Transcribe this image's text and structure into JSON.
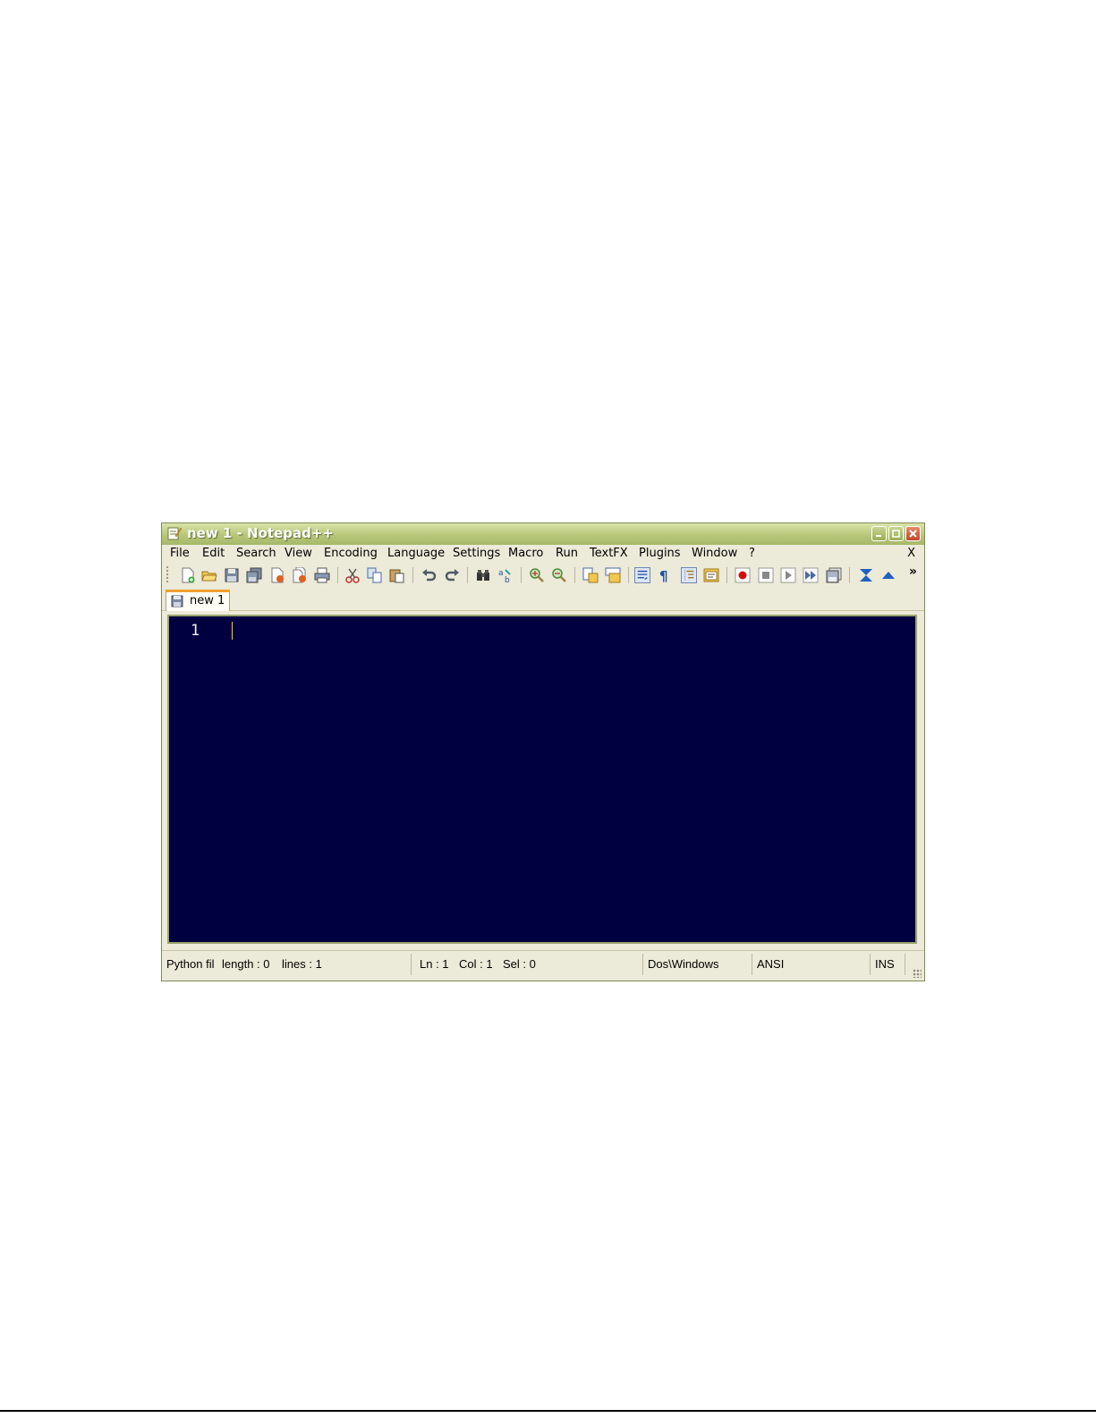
{
  "window": {
    "title": "new  1 - Notepad++"
  },
  "menu": {
    "items": [
      "File",
      "Edit",
      "Search",
      "View",
      "Encoding",
      "Language",
      "Settings",
      "Macro",
      "Run",
      "TextFX",
      "Plugins",
      "Window",
      "?"
    ],
    "close_label": "X"
  },
  "toolbar": {
    "overflow_label": "»",
    "icons": [
      "new-file-icon",
      "open-file-icon",
      "save-icon",
      "save-all-icon",
      "close-icon",
      "close-all-icon",
      "print-icon",
      "cut-icon",
      "copy-icon",
      "paste-icon",
      "undo-icon",
      "redo-icon",
      "find-icon",
      "replace-icon",
      "zoom-in-icon",
      "zoom-out-icon",
      "sync-vertical-icon",
      "sync-horizontal-icon",
      "word-wrap-icon",
      "show-all-chars-icon",
      "indent-guide-icon",
      "user-defined-lang-icon",
      "record-macro-icon",
      "stop-macro-icon",
      "play-macro-icon",
      "run-macro-multiple-icon",
      "save-macro-icon",
      "trim-icon",
      "move-up-icon"
    ]
  },
  "tabs": [
    {
      "label": "new  1"
    }
  ],
  "editor": {
    "line_numbers": [
      "1"
    ]
  },
  "status": {
    "filetype": "Python fil",
    "length": "length : 0",
    "lines": "lines : 1",
    "ln": "Ln : 1",
    "col": "Col : 1",
    "sel": "Sel : 0",
    "eol": "Dos\\Windows",
    "encoding": "ANSI",
    "mode": "INS"
  },
  "colors": {
    "editor_background": "#000040",
    "caret": "#ffd400",
    "titlebar": "#b7c77a"
  }
}
